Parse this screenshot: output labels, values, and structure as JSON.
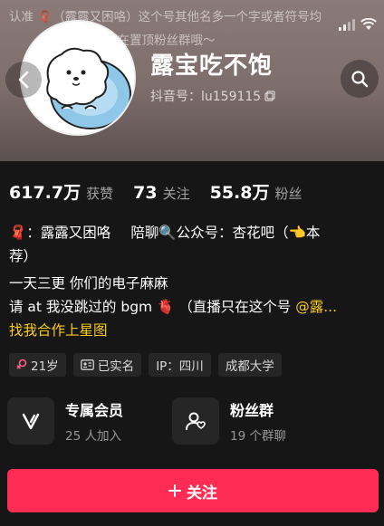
{
  "banner": {
    "line1": "认准 🧣（露露又困咯）这个号其他名多一个字或者符号均",
    "line2": "都在置顶粉丝群哦～"
  },
  "profile": {
    "nickname": "露宝吃不饱",
    "douyin_id": "抖音号：lu159115"
  },
  "stats": [
    {
      "num": "617.7万",
      "label": "获赞"
    },
    {
      "num": "73",
      "label": "关注"
    },
    {
      "num": "55.8万",
      "label": "粉丝"
    }
  ],
  "bio": {
    "line1_a": "🧣：露露又困咯",
    "line1_b": "陪聊🔍公众号：杏花吧（👈本",
    "line2": "荐）",
    "line3": "一天三更 你们的电子麻麻",
    "line4_a": "请 at 我没跳过的 bgm 🫀 （直播只在这个号",
    "line4_mention": "@露...",
    "line5": "找我合作上星图"
  },
  "tags": [
    {
      "icon": "gender-female-icon",
      "label": "21岁"
    },
    {
      "icon": "id-card-icon",
      "label": "已实名"
    },
    {
      "icon": "",
      "label": "IP：四川"
    },
    {
      "icon": "",
      "label": "成都大学"
    }
  ],
  "features": [
    {
      "icon": "member-v-icon",
      "title": "专属会员",
      "sub": "25 人加入"
    },
    {
      "icon": "fans-group-icon",
      "title": "粉丝群",
      "sub": "19 个群聊"
    }
  ],
  "follow": {
    "label": "关注"
  },
  "colors": {
    "accent": "#fe2c55",
    "gold": "#face15",
    "bg": "#161616"
  }
}
